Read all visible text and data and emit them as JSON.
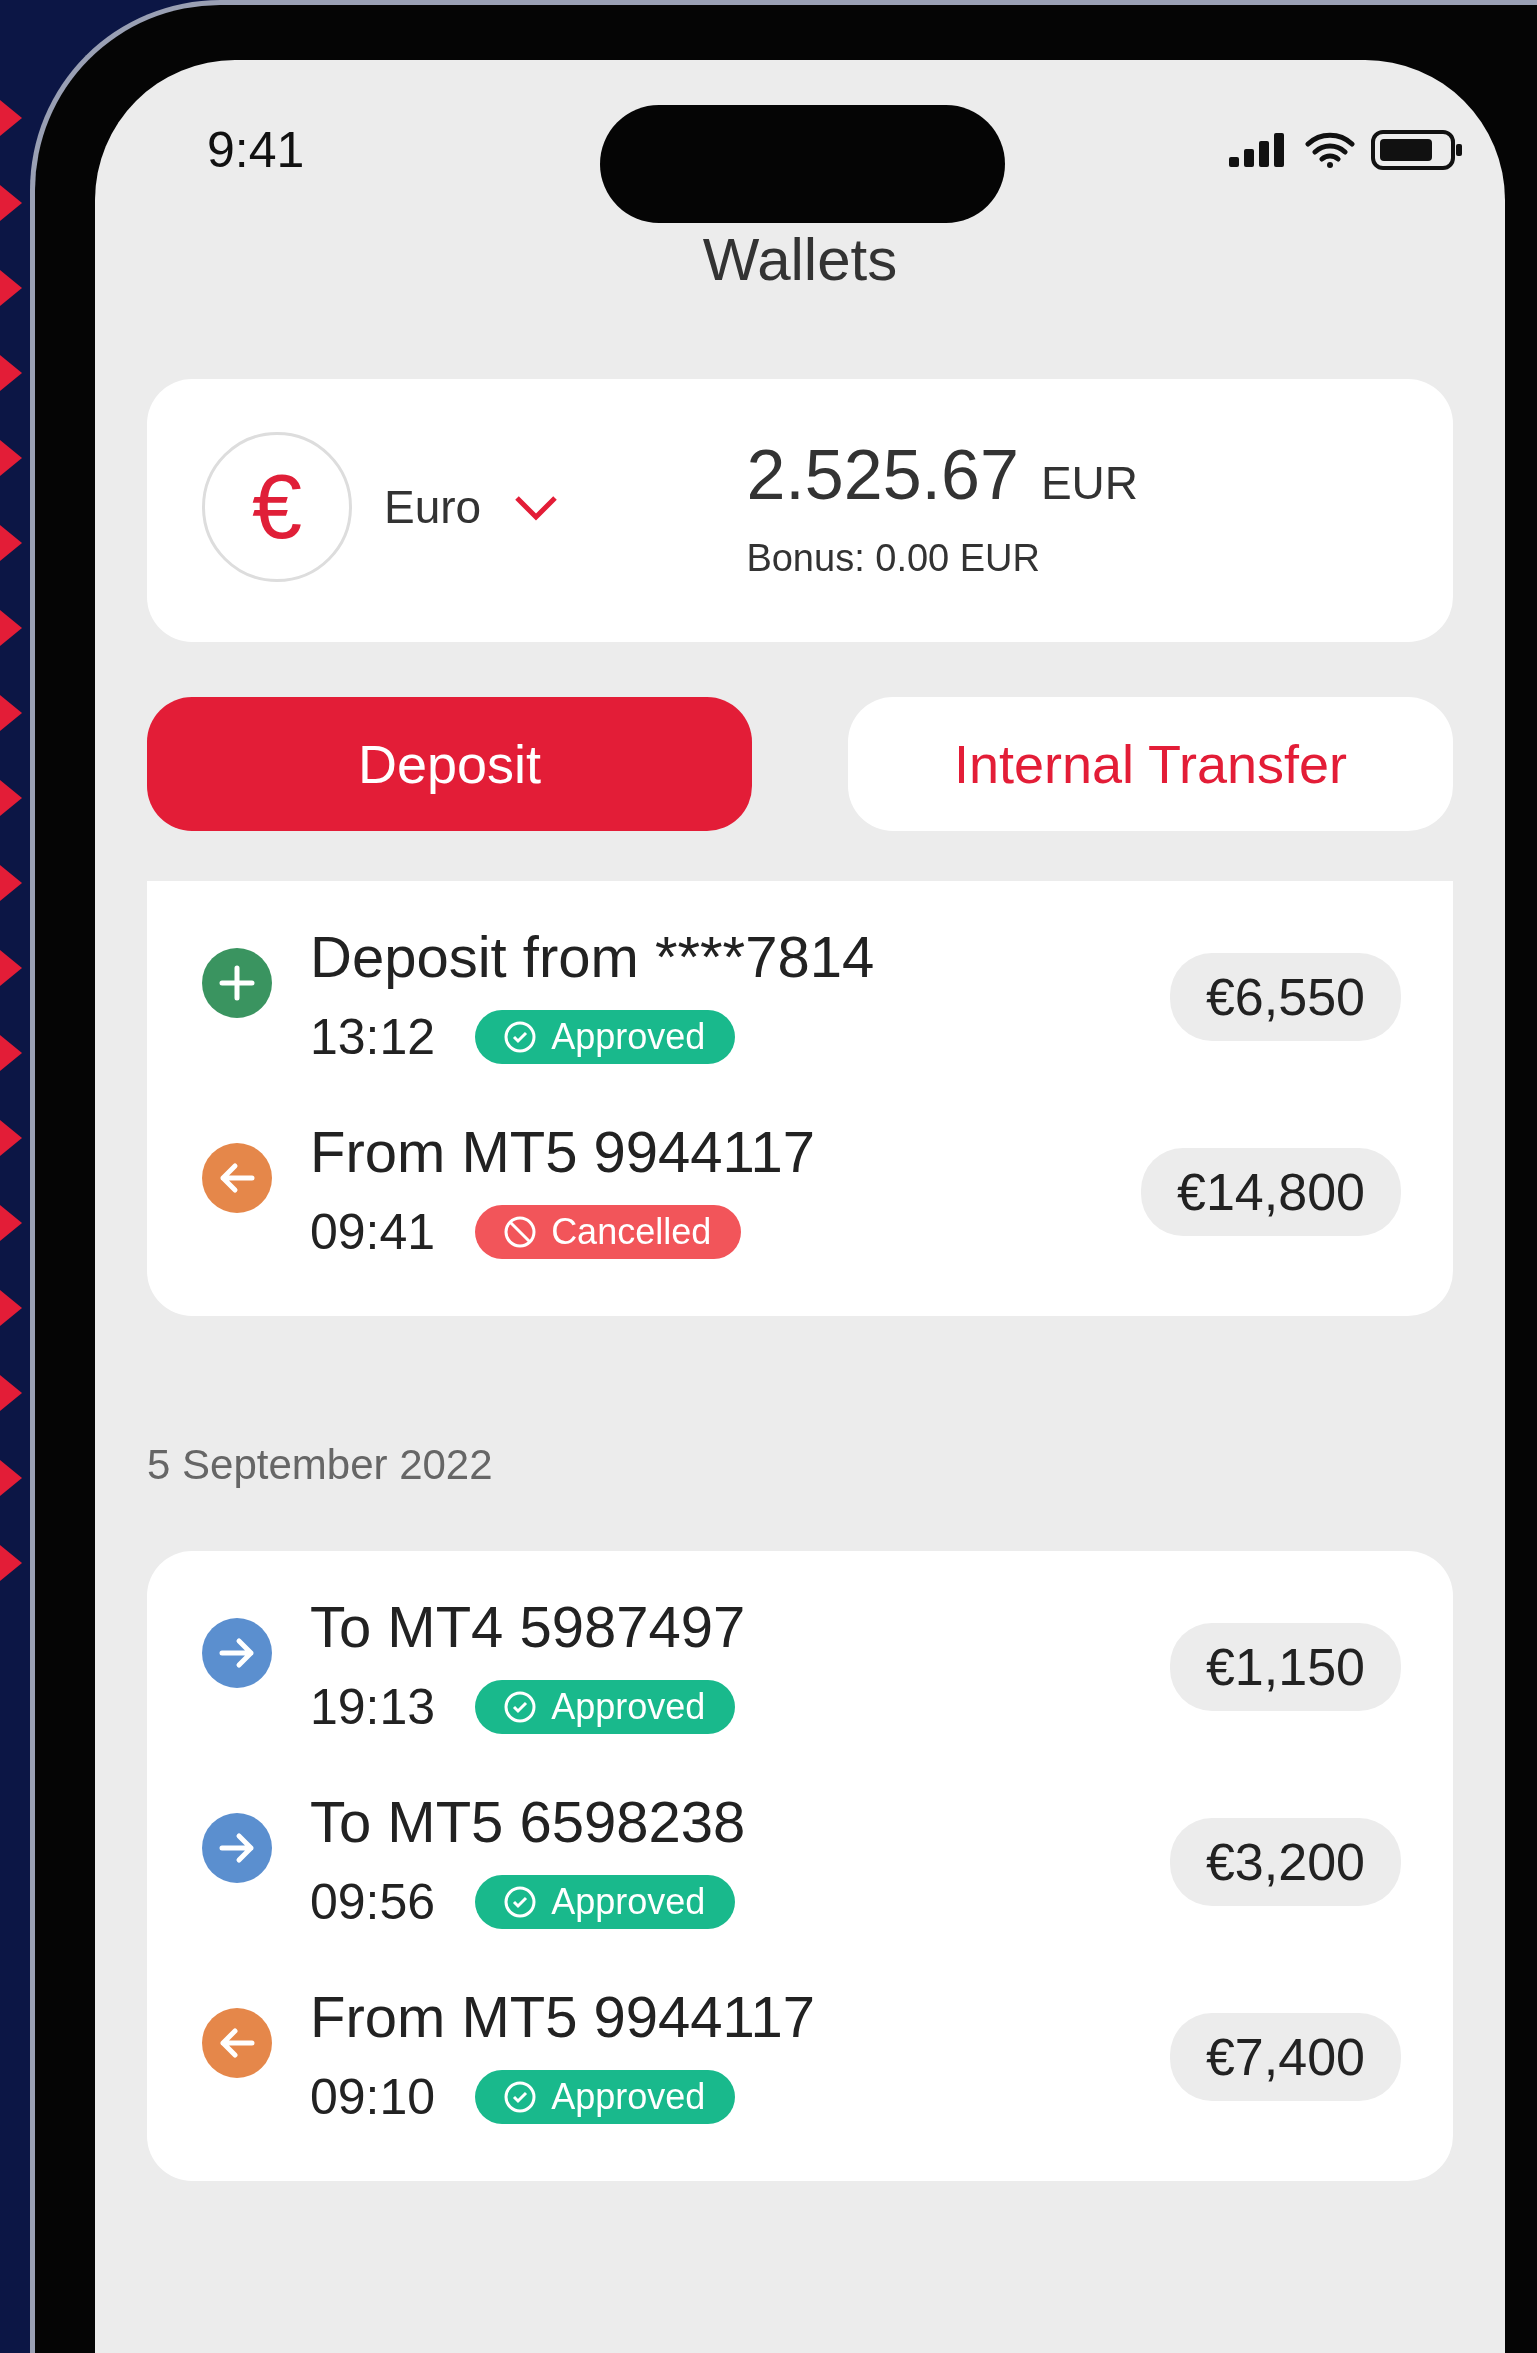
{
  "status_bar": {
    "time": "9:41"
  },
  "title": "Wallets",
  "wallet": {
    "currency_symbol": "€",
    "currency": "Euro",
    "balance": "2.525.67",
    "balance_unit": "EUR",
    "bonus": "Bonus: 0.00  EUR"
  },
  "buttons": [
    {
      "label": "Deposit",
      "kind": "primary"
    },
    {
      "label": "Internal Transfer",
      "kind": "secondary"
    }
  ],
  "groups": [
    {
      "transactions": [
        {
          "kind": "deposit",
          "title": "Deposit from ****7814",
          "time": "13:12",
          "status": {
            "label": "Approved",
            "kind": "approved"
          },
          "amount": "€6,550"
        },
        {
          "kind": "incoming",
          "title": "From MT5 9944117",
          "time": "09:41",
          "status": {
            "label": "Cancelled",
            "kind": "cancelled"
          },
          "amount": "€14,800"
        }
      ]
    },
    {
      "date": "5 September 2022",
      "transactions": [
        {
          "kind": "outgoing",
          "title": "To MT4 5987497",
          "time": "19:13",
          "status": {
            "label": "Approved",
            "kind": "approved"
          },
          "amount": "€1,150"
        },
        {
          "kind": "outgoing",
          "title": "To MT5 6598238",
          "time": "09:56",
          "status": {
            "label": "Approved",
            "kind": "approved"
          },
          "amount": "€3,200"
        },
        {
          "kind": "incoming",
          "title": "From MT5 9944117",
          "time": "09:10",
          "status": {
            "label": "Approved",
            "kind": "approved"
          },
          "amount": "€7,400"
        }
      ]
    }
  ]
}
